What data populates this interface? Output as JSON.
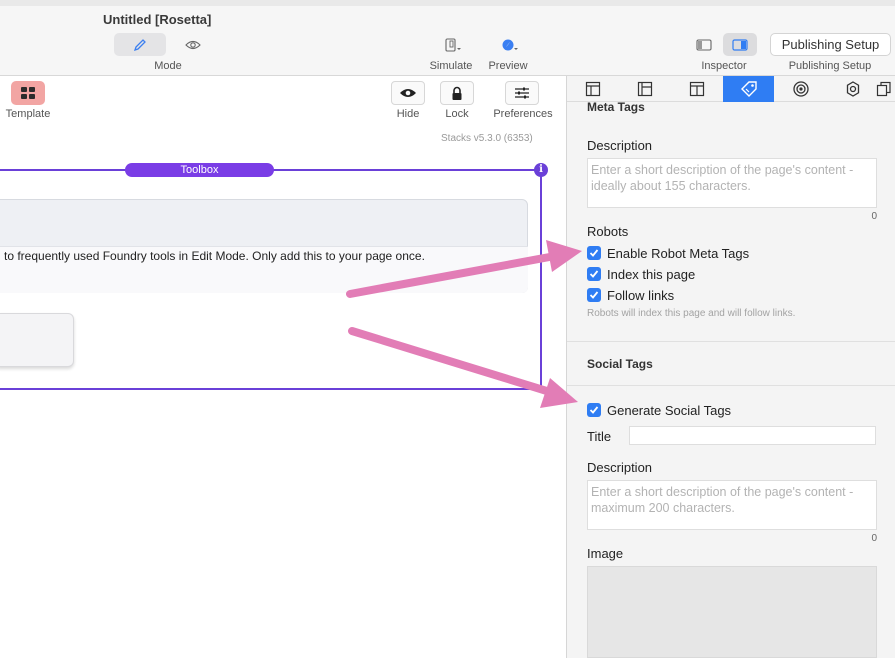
{
  "window": {
    "title": "Untitled [Rosetta]"
  },
  "toolbar": {
    "mode_label": "Mode",
    "simulate_label": "Simulate",
    "preview_label": "Preview",
    "inspector_label": "Inspector",
    "publishing_button": "Publishing Setup",
    "publishing_label": "Publishing Setup"
  },
  "editor": {
    "template_label": "Template",
    "hide_label": "Hide",
    "lock_label": "Lock",
    "preferences_label": "Preferences",
    "stacks_version": "Stacks v5.3.0 (6353)",
    "toolbox_tab": "Toolbox",
    "info_text": "to frequently used Foundry tools in Edit Mode. Only add this to your page once."
  },
  "inspector": {
    "active_tab_index": 3,
    "tabs": [
      "layout-icon",
      "page-icon",
      "columns-icon",
      "tag-icon",
      "target-icon",
      "gear-icon",
      "pages-icon"
    ],
    "meta_heading": "Meta Tags",
    "description_label": "Description",
    "description_placeholder": "Enter a short description of the page's content - ideally about 155 characters.",
    "description_count": "0",
    "robots_label": "Robots",
    "robots_checks": [
      {
        "label": "Enable Robot Meta Tags",
        "checked": true
      },
      {
        "label": "Index this page",
        "checked": true
      },
      {
        "label": "Follow links",
        "checked": true
      }
    ],
    "robots_hint": "Robots will index this page and will follow links.",
    "social_heading": "Social Tags",
    "generate_social": {
      "label": "Generate Social Tags",
      "checked": true
    },
    "title_label": "Title",
    "title_value": "",
    "social_description_label": "Description",
    "social_description_placeholder": "Enter a short description of the page's content - maximum 200 characters.",
    "social_description_count": "0",
    "image_label": "Image"
  },
  "colors": {
    "accent": "#2f7df3",
    "toolbox_purple": "#6a40d8",
    "arrow_pink": "#e27db6",
    "template_red": "#f2a5a3"
  }
}
